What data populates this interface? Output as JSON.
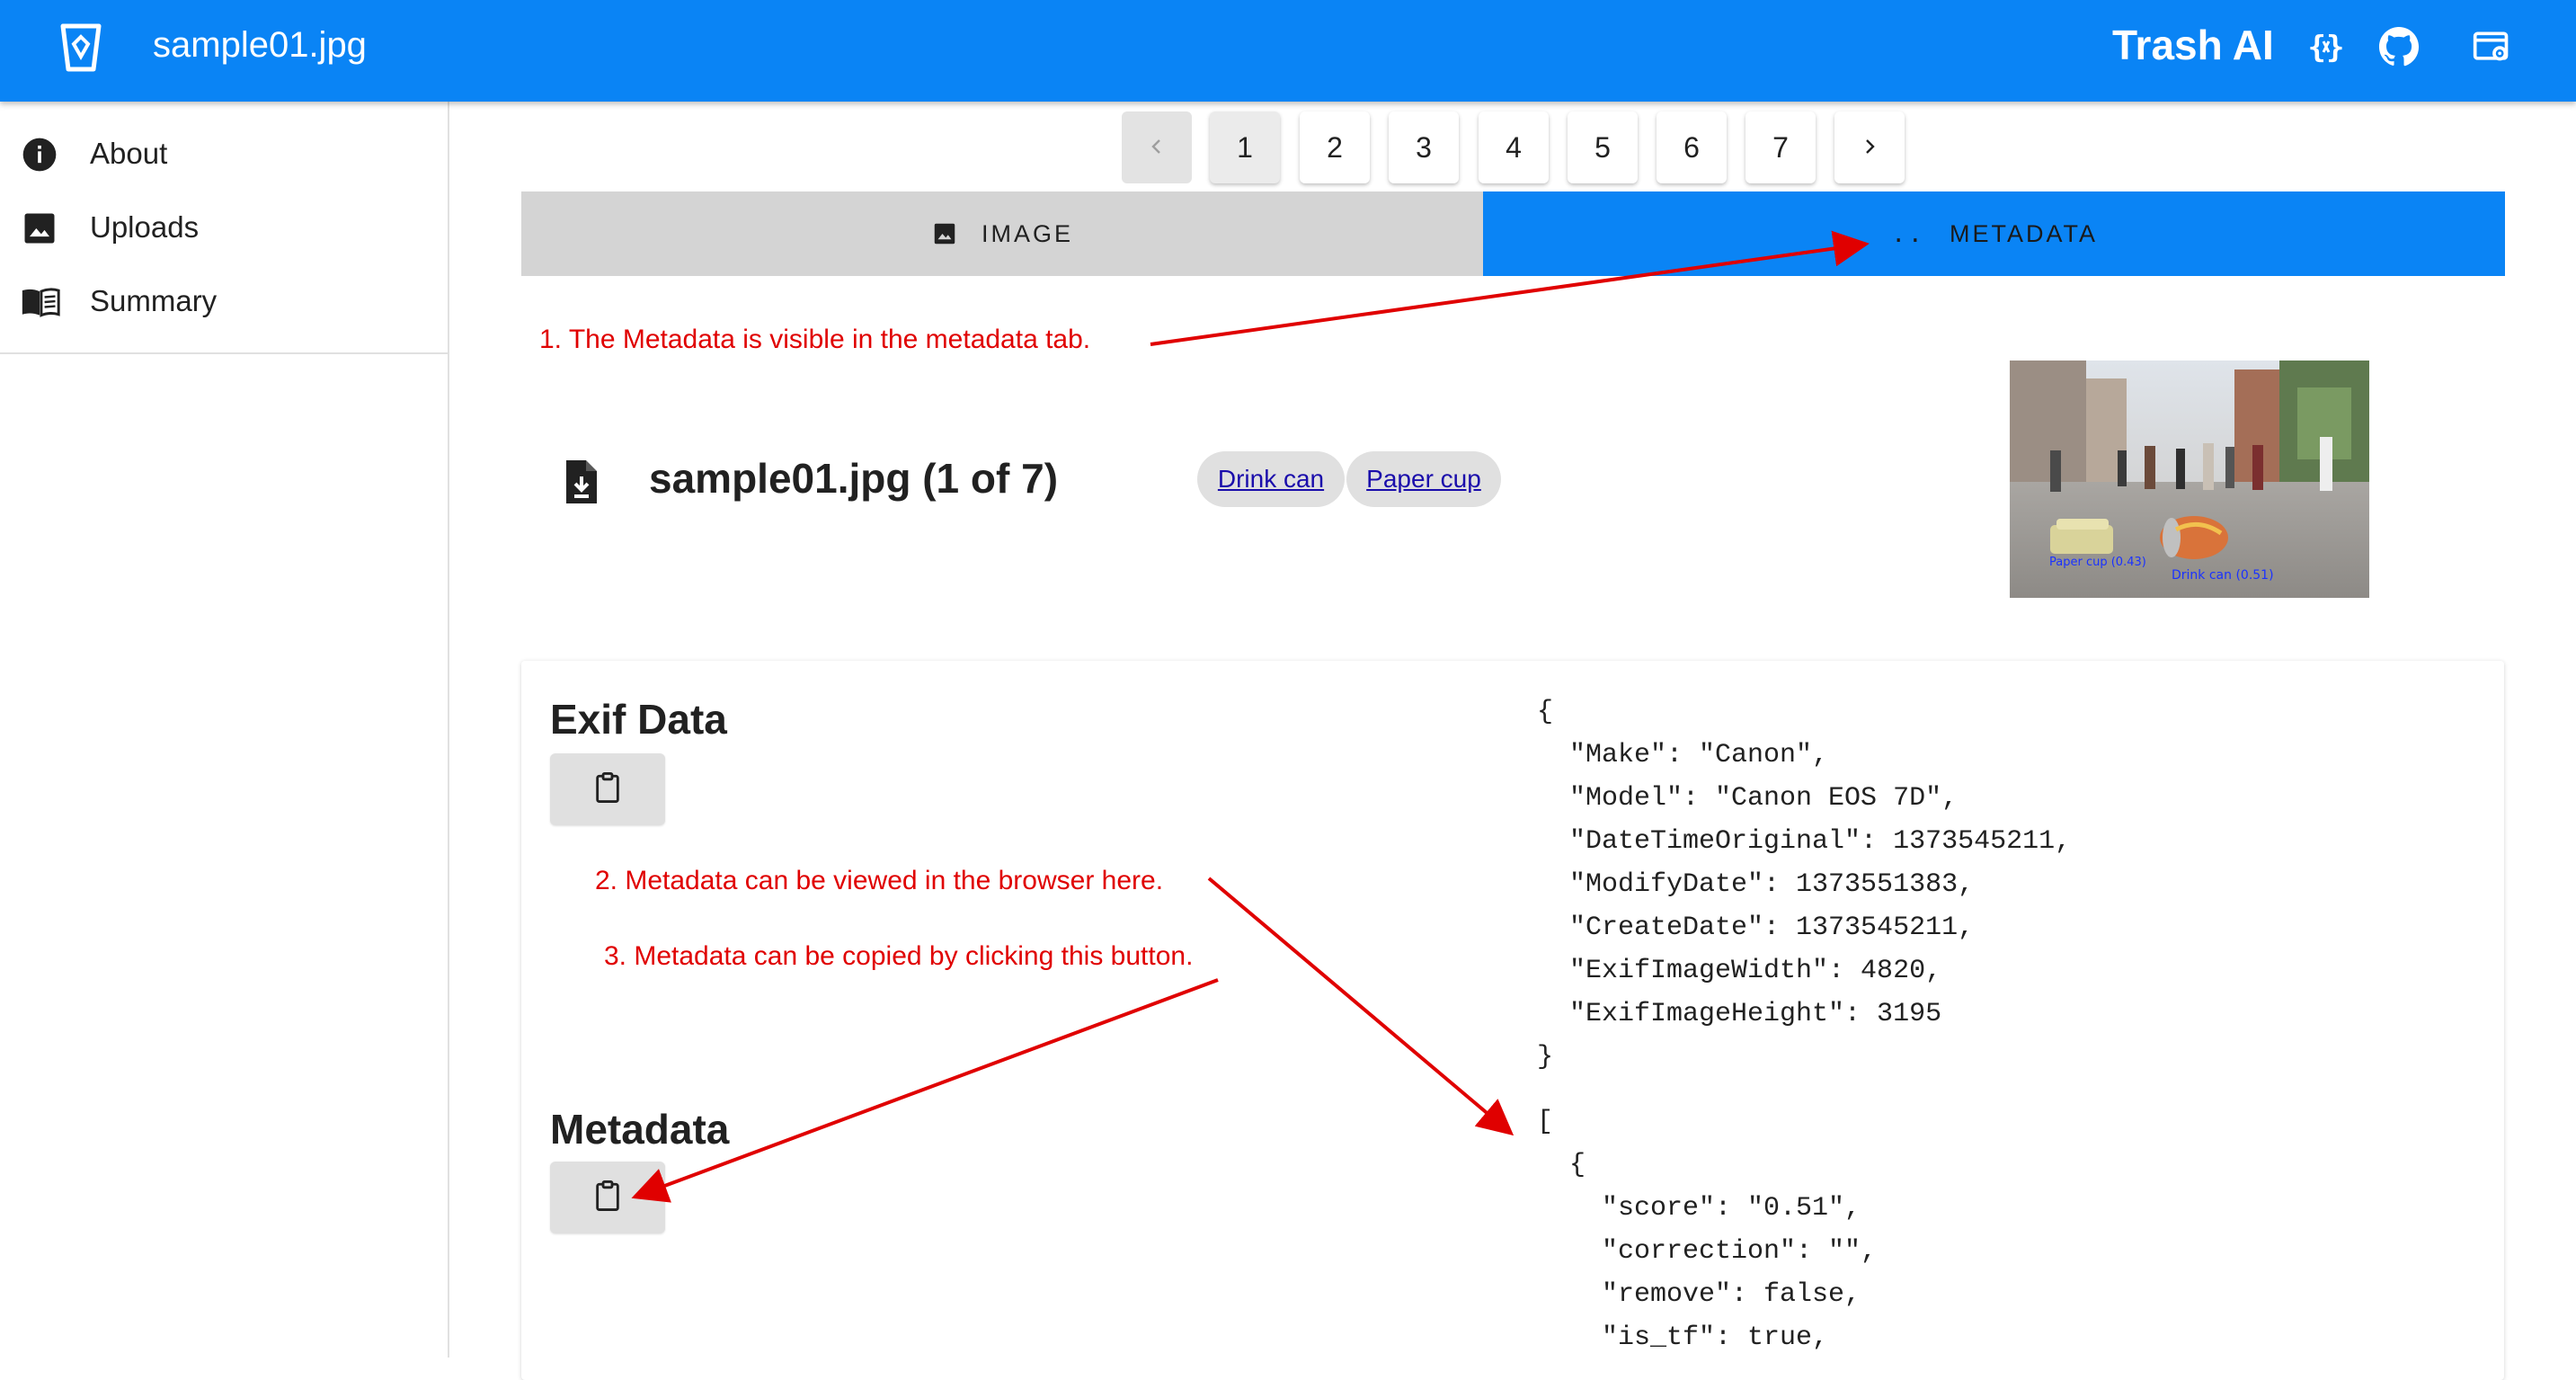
{
  "appbar": {
    "title": "sample01.jpg",
    "brand": "Trash AI",
    "icons": [
      "trash-bin-logo-icon",
      "code-braces-icon",
      "github-icon",
      "settings-window-icon"
    ]
  },
  "sidebar": {
    "items": [
      {
        "label": "About",
        "icon": "info-icon"
      },
      {
        "label": "Uploads",
        "icon": "image-icon"
      },
      {
        "label": "Summary",
        "icon": "book-icon"
      }
    ]
  },
  "pagination": {
    "pages": [
      "1",
      "2",
      "3",
      "4",
      "5",
      "6",
      "7"
    ],
    "current": "1"
  },
  "tabs": [
    {
      "label": "IMAGE",
      "icon": "image-icon",
      "active": false
    },
    {
      "label": "METADATA",
      "icon": "code-braces-icon",
      "active": true
    }
  ],
  "annotations": {
    "a1": "1. The Metadata is visible in the metadata tab.",
    "a2": "2. Metadata can be viewed in the browser here.",
    "a3": "3. Metadata can be copied by clicking this button."
  },
  "file": {
    "title": "sample01.jpg (1 of 7)",
    "tags": [
      "Drink can",
      "Paper cup"
    ]
  },
  "thumbnail": {
    "labels": [
      "Paper cup (0.43)",
      "Drink can (0.51)"
    ]
  },
  "sections": {
    "exif_heading": "Exif Data",
    "metadata_heading": "Metadata"
  },
  "exif_json": "{\n  \"Make\": \"Canon\",\n  \"Model\": \"Canon EOS 7D\",\n  \"DateTimeOriginal\": 1373545211,\n  \"ModifyDate\": 1373551383,\n  \"CreateDate\": 1373545211,\n  \"ExifImageWidth\": 4820,\n  \"ExifImageHeight\": 3195\n}",
  "metadata_json": "[\n  {\n    \"score\": \"0.51\",\n    \"correction\": \"\",\n    \"remove\": false,\n    \"is_tf\": true,",
  "colors": {
    "primary": "#0a84f5",
    "annotation": "#e00000",
    "chip_bg": "#e0e0e0",
    "tab_inactive": "#d4d4d4"
  }
}
